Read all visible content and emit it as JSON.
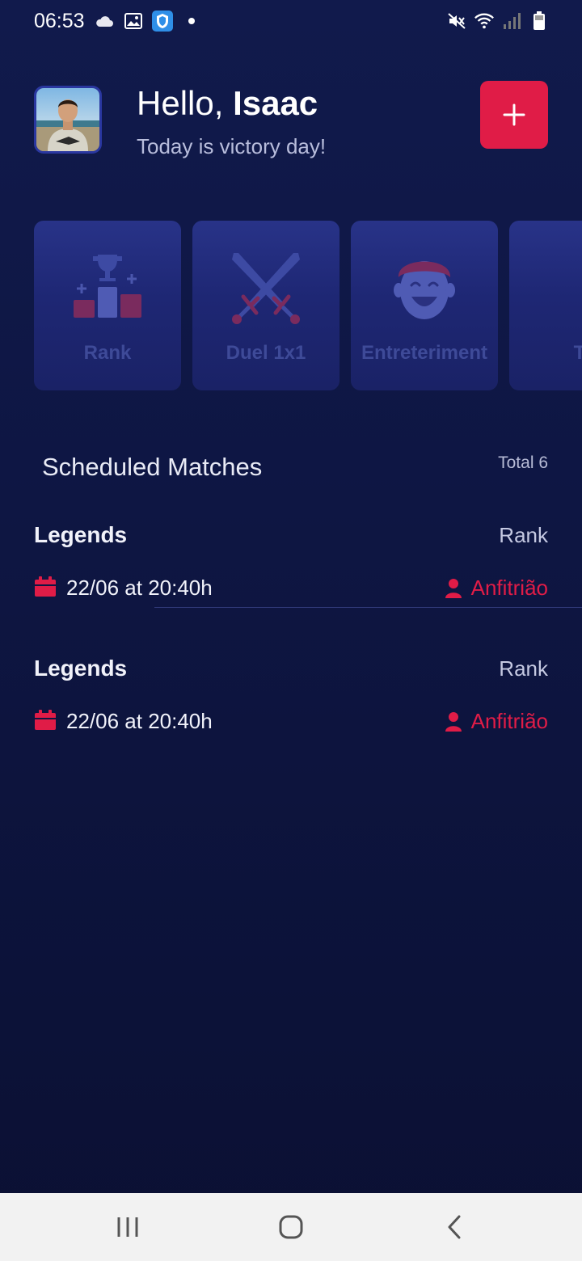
{
  "status_bar": {
    "time": "06:53",
    "left_icons": [
      "cloud-icon",
      "image-icon",
      "shield-icon",
      "dot-icon"
    ],
    "right_icons": [
      "mute-icon",
      "wifi-icon",
      "signal-icon",
      "battery-icon"
    ]
  },
  "header": {
    "greeting_prefix": "Hello,",
    "user_name": "Isaac",
    "subtitle": "Today is victory day!",
    "add_label": "+"
  },
  "categories": [
    {
      "label": "Rank",
      "icon": "trophy-podium-icon"
    },
    {
      "label": "Duel 1x1",
      "icon": "crossed-swords-icon"
    },
    {
      "label": "Entreteriment",
      "icon": "smiling-face-icon"
    },
    {
      "label": "Tr",
      "icon": "gamepad-icon"
    }
  ],
  "scheduled": {
    "title": "Scheduled Matches",
    "total": "Total 6",
    "matches": [
      {
        "name": "Legends",
        "type": "Rank",
        "date": "22/06 at 20:40h",
        "host": "Anfitrião"
      },
      {
        "name": "Legends",
        "type": "Rank",
        "date": "22/06 at 20:40h",
        "host": "Anfitrião"
      }
    ]
  },
  "colors": {
    "accent": "#e01c47",
    "background": "#0e1643",
    "card": "#1e2774",
    "card_text": "#3e4a98"
  },
  "nav_bar": {
    "buttons": [
      "recent-apps-icon",
      "home-icon",
      "back-icon"
    ]
  }
}
